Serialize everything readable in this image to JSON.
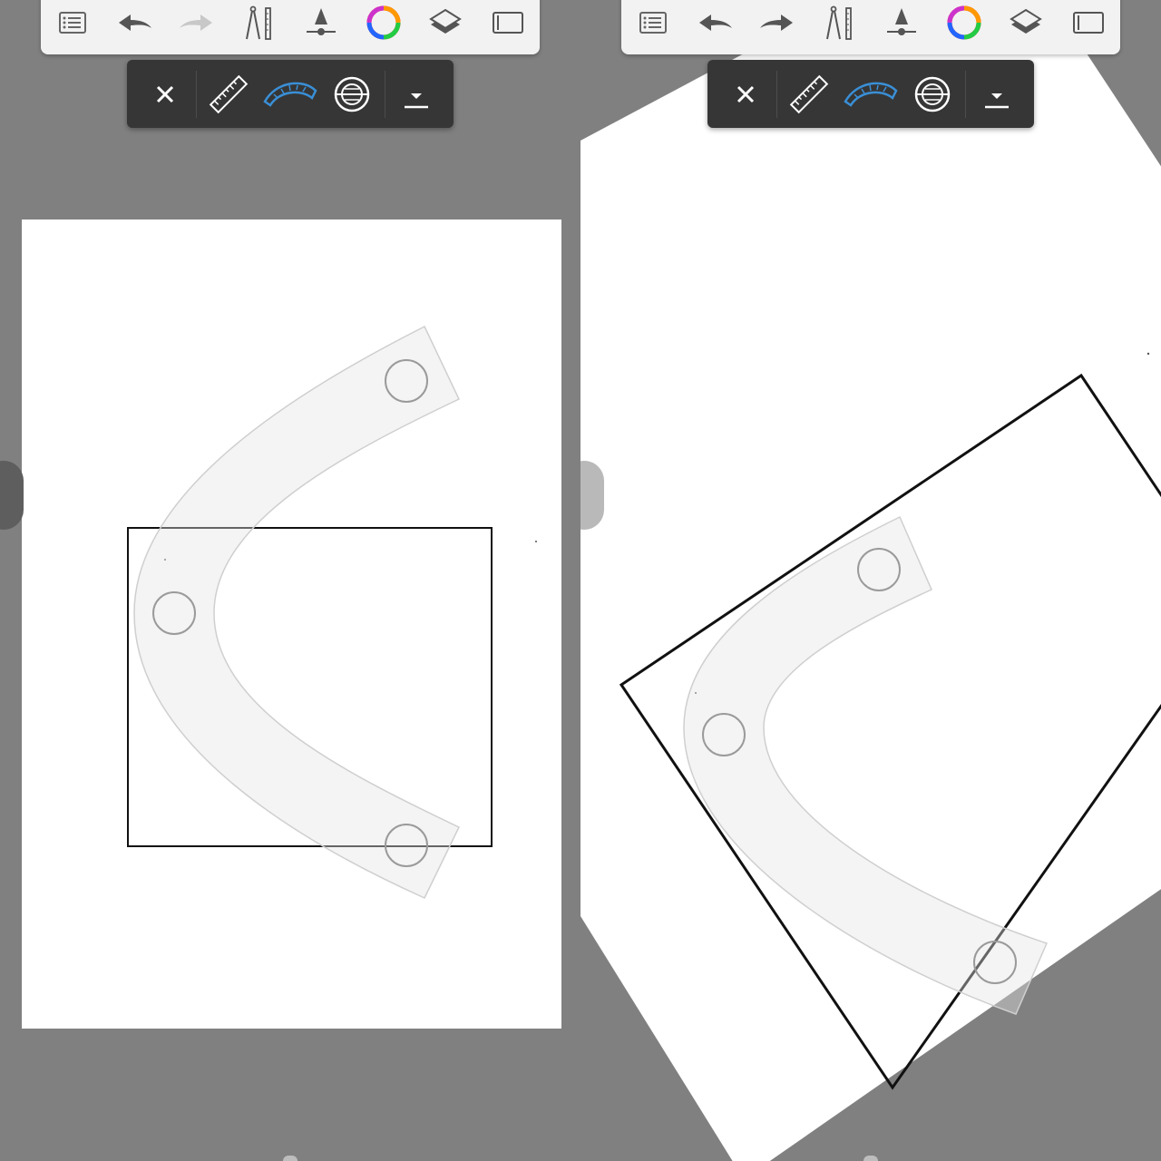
{
  "left_view": {
    "redo_enabled": false,
    "canvas_background": "#ffffff",
    "guide": "curve-ruler"
  },
  "right_view": {
    "redo_enabled": true,
    "canvas_background": "#ffffff",
    "guide": "curve-ruler",
    "canvas_rotation_deg": -33
  },
  "toolbar": {
    "icons": [
      "list-icon",
      "undo-icon",
      "redo-icon",
      "ruler-compass-icon",
      "brush-size-icon",
      "color-wheel-icon",
      "layers-icon",
      "canvas-frame-icon"
    ]
  },
  "guide_bar": {
    "icons": [
      "close-icon",
      "straight-ruler-icon",
      "french-curve-icon",
      "ellipse-guide-icon",
      "collapse-icon"
    ],
    "active_icon": "french-curve-icon"
  },
  "colors": {
    "background": "#808080",
    "toolbar": "#f2f2f2",
    "guide_bar": "#363636",
    "accent": "#3a8fd6",
    "icon_light": "#ffffff",
    "icon_dark": "#555555"
  }
}
